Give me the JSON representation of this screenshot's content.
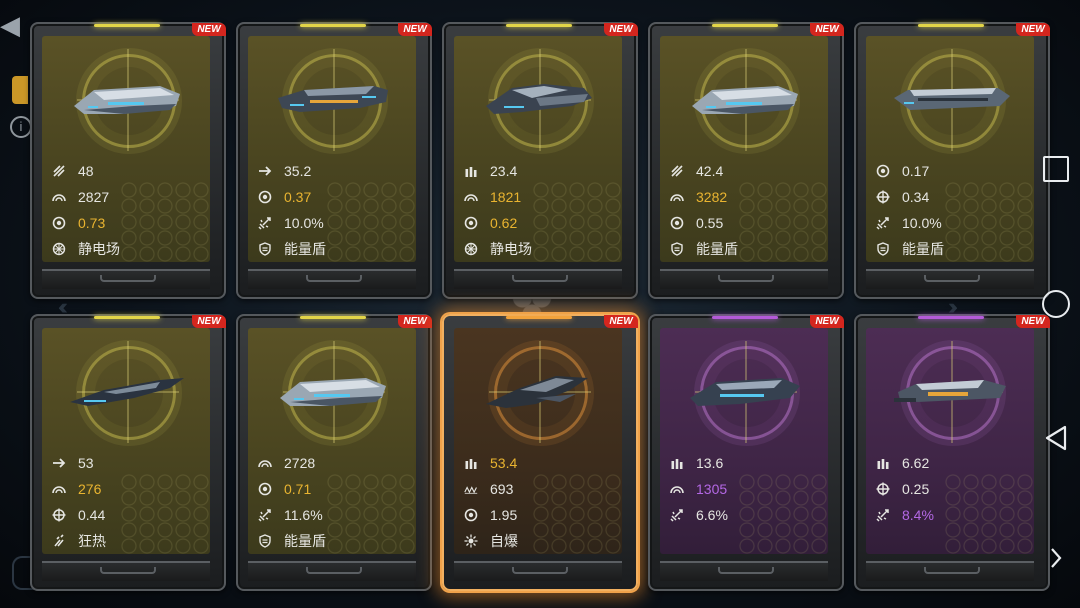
{
  "new_badge": "NEW",
  "colors": {
    "gold": "#e9b430",
    "violet": "#b468e5",
    "new_red": "#d4261e",
    "select_glow": "#f0a24a"
  },
  "cards": [
    {
      "theme": "yellow",
      "ship": "cruiser-a",
      "stats": [
        {
          "icon": "speed-icon",
          "value": "48",
          "color": ""
        },
        {
          "icon": "armor-icon",
          "value": "2827",
          "color": ""
        },
        {
          "icon": "shield-ring-icon",
          "value": "0.73",
          "color": "gold"
        },
        {
          "icon": "static-field-icon",
          "value": "静电场",
          "color": ""
        }
      ]
    },
    {
      "theme": "yellow",
      "ship": "destroyer-a",
      "stats": [
        {
          "icon": "arrow-icon",
          "value": "35.2",
          "color": ""
        },
        {
          "icon": "shield-ring-icon",
          "value": "0.37",
          "color": "gold"
        },
        {
          "icon": "missile-icon",
          "value": "10.0%",
          "color": ""
        },
        {
          "icon": "energy-shield-icon",
          "value": "能量盾",
          "color": ""
        }
      ]
    },
    {
      "theme": "yellow",
      "ship": "frigate-a",
      "stats": [
        {
          "icon": "ammo-icon",
          "value": "23.4",
          "color": ""
        },
        {
          "icon": "armor-icon",
          "value": "1821",
          "color": "gold"
        },
        {
          "icon": "shield-ring-icon",
          "value": "0.62",
          "color": "gold"
        },
        {
          "icon": "static-field-icon",
          "value": "静电场",
          "color": ""
        }
      ]
    },
    {
      "theme": "yellow",
      "ship": "cruiser-a",
      "stats": [
        {
          "icon": "speed-icon",
          "value": "42.4",
          "color": ""
        },
        {
          "icon": "armor-icon",
          "value": "3282",
          "color": "gold"
        },
        {
          "icon": "shield-ring-icon",
          "value": "0.55",
          "color": ""
        },
        {
          "icon": "energy-shield-icon",
          "value": "能量盾",
          "color": ""
        }
      ]
    },
    {
      "theme": "yellow",
      "ship": "carrier-a",
      "stats": [
        {
          "icon": "shield-ring-icon",
          "value": "0.17",
          "color": ""
        },
        {
          "icon": "crosshair-icon",
          "value": "0.34",
          "color": ""
        },
        {
          "icon": "missile-icon",
          "value": "10.0%",
          "color": ""
        },
        {
          "icon": "energy-shield-icon",
          "value": "能量盾",
          "color": ""
        }
      ]
    },
    {
      "theme": "yellow",
      "ship": "interceptor-a",
      "stats": [
        {
          "icon": "arrow-icon",
          "value": "53",
          "color": ""
        },
        {
          "icon": "armor-icon",
          "value": "276",
          "color": "gold"
        },
        {
          "icon": "crosshair-icon",
          "value": "0.44",
          "color": ""
        },
        {
          "icon": "frenzy-icon",
          "value": "狂热",
          "color": ""
        }
      ]
    },
    {
      "theme": "yellow",
      "ship": "cruiser-a",
      "stats": [
        {
          "icon": "armor-icon",
          "value": "2728",
          "color": ""
        },
        {
          "icon": "shield-ring-icon",
          "value": "0.71",
          "color": "gold"
        },
        {
          "icon": "missile-icon",
          "value": "11.6%",
          "color": ""
        },
        {
          "icon": "energy-shield-icon",
          "value": "能量盾",
          "color": ""
        }
      ]
    },
    {
      "theme": "orange",
      "selected": true,
      "ship": "fighter-a",
      "stats": [
        {
          "icon": "ammo-icon",
          "value": "53.4",
          "color": "gold"
        },
        {
          "icon": "wave-icon",
          "value": "693",
          "color": ""
        },
        {
          "icon": "shield-ring-icon",
          "value": "1.95",
          "color": ""
        },
        {
          "icon": "self-destruct-icon",
          "value": "自爆",
          "color": ""
        }
      ]
    },
    {
      "theme": "purple",
      "ship": "frigate-b",
      "stats": [
        {
          "icon": "ammo-icon",
          "value": "13.6",
          "color": ""
        },
        {
          "icon": "armor-icon",
          "value": "1305",
          "color": "violet"
        },
        {
          "icon": "missile-icon",
          "value": "6.6%",
          "color": ""
        }
      ]
    },
    {
      "theme": "purple",
      "ship": "gunship-b",
      "stats": [
        {
          "icon": "ammo-icon",
          "value": "6.62",
          "color": ""
        },
        {
          "icon": "crosshair-icon",
          "value": "0.25",
          "color": ""
        },
        {
          "icon": "missile-icon",
          "value": "8.4%",
          "color": "violet"
        }
      ]
    }
  ]
}
